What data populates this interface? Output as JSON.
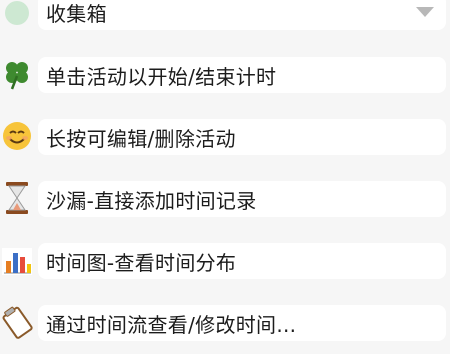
{
  "inbox": {
    "label": "收集箱",
    "icon": "light-green-circle-icon"
  },
  "items": [
    {
      "label": "单击活动以开始/结束计时",
      "icon": "four-leaf-clover-icon"
    },
    {
      "label": "长按可编辑/删除活动",
      "icon": "smiling-face-icon"
    },
    {
      "label": "沙漏-直接添加时间记录",
      "icon": "hourglass-icon"
    },
    {
      "label": "时间图-查看时间分布",
      "icon": "bar-chart-icon"
    },
    {
      "label": "通过时间流查看/修改时间...",
      "icon": "clipboard-icon"
    }
  ],
  "colors": {
    "inbox_dot": "#cde8d2",
    "card": "#ffffff",
    "background": "#f6f6f6"
  }
}
